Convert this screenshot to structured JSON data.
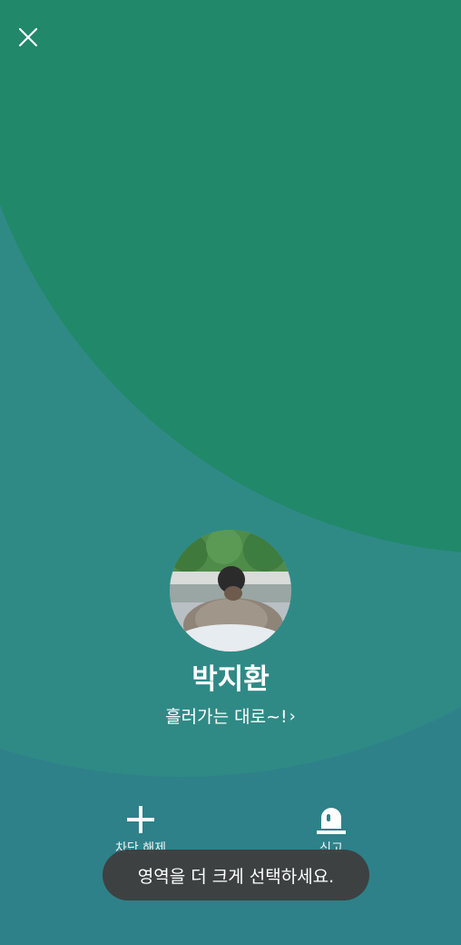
{
  "profile": {
    "name": "박지환",
    "status_message": "흘러가는 대로~!",
    "status_chevron": "›"
  },
  "actions": {
    "unblock_label": "차단 해제",
    "report_label": "신고"
  },
  "toast": {
    "message": "영역을 더 크게 선택하세요."
  },
  "colors": {
    "background": "#2e8189",
    "shape_top": "#21886a",
    "shape_middle": "#2f8a86",
    "toast": "#3e3e3e"
  },
  "icons": {
    "close": "close-icon",
    "unblock": "plus-icon",
    "report": "siren-icon"
  }
}
